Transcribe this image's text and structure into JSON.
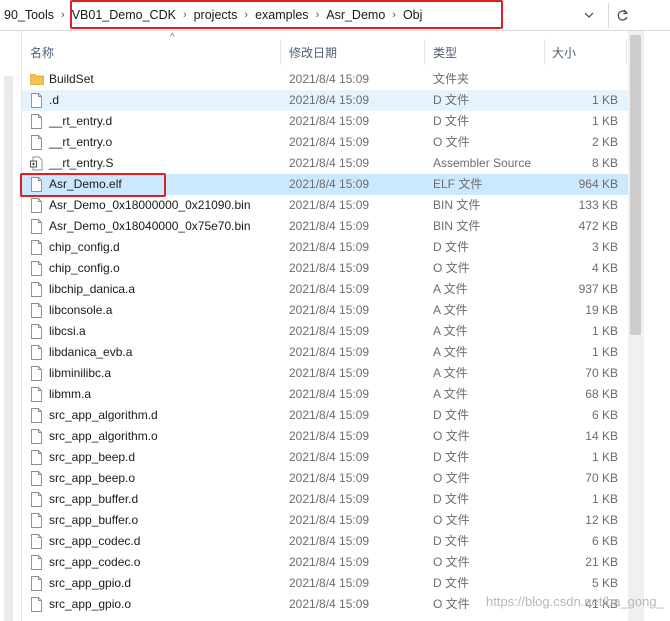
{
  "breadcrumb": {
    "items": [
      "90_Tools",
      "VB01_Demo_CDK",
      "projects",
      "examples",
      "Asr_Demo",
      "Obj"
    ],
    "separator": "›"
  },
  "address_bar": {
    "dropdown_icon": "chevron-down-icon",
    "refresh_icon": "refresh-icon"
  },
  "columns": {
    "name": "名称",
    "date": "修改日期",
    "type": "类型",
    "size": "大小",
    "sort_indicator": "^"
  },
  "files": [
    {
      "name": "BuildSet",
      "date": "2021/8/4 15:09",
      "type": "文件夹",
      "size": "",
      "icon": "folder-icon"
    },
    {
      "name": ".d",
      "date": "2021/8/4 15:09",
      "type": "D 文件",
      "size": "1 KB",
      "icon": "file-icon"
    },
    {
      "name": "__rt_entry.d",
      "date": "2021/8/4 15:09",
      "type": "D 文件",
      "size": "1 KB",
      "icon": "file-icon"
    },
    {
      "name": "__rt_entry.o",
      "date": "2021/8/4 15:09",
      "type": "O 文件",
      "size": "2 KB",
      "icon": "file-icon"
    },
    {
      "name": "__rt_entry.S",
      "date": "2021/8/4 15:09",
      "type": "Assembler Source",
      "size": "8 KB",
      "icon": "assembler-source-icon"
    },
    {
      "name": "Asr_Demo.elf",
      "date": "2021/8/4 15:09",
      "type": "ELF 文件",
      "size": "964 KB",
      "icon": "file-icon"
    },
    {
      "name": "Asr_Demo_0x18000000_0x21090.bin",
      "date": "2021/8/4 15:09",
      "type": "BIN 文件",
      "size": "133 KB",
      "icon": "file-icon"
    },
    {
      "name": "Asr_Demo_0x18040000_0x75e70.bin",
      "date": "2021/8/4 15:09",
      "type": "BIN 文件",
      "size": "472 KB",
      "icon": "file-icon"
    },
    {
      "name": "chip_config.d",
      "date": "2021/8/4 15:09",
      "type": "D 文件",
      "size": "3 KB",
      "icon": "file-icon"
    },
    {
      "name": "chip_config.o",
      "date": "2021/8/4 15:09",
      "type": "O 文件",
      "size": "4 KB",
      "icon": "file-icon"
    },
    {
      "name": "libchip_danica.a",
      "date": "2021/8/4 15:09",
      "type": "A 文件",
      "size": "937 KB",
      "icon": "file-icon"
    },
    {
      "name": "libconsole.a",
      "date": "2021/8/4 15:09",
      "type": "A 文件",
      "size": "19 KB",
      "icon": "file-icon"
    },
    {
      "name": "libcsi.a",
      "date": "2021/8/4 15:09",
      "type": "A 文件",
      "size": "1 KB",
      "icon": "file-icon"
    },
    {
      "name": "libdanica_evb.a",
      "date": "2021/8/4 15:09",
      "type": "A 文件",
      "size": "1 KB",
      "icon": "file-icon"
    },
    {
      "name": "libminilibc.a",
      "date": "2021/8/4 15:09",
      "type": "A 文件",
      "size": "70 KB",
      "icon": "file-icon"
    },
    {
      "name": "libmm.a",
      "date": "2021/8/4 15:09",
      "type": "A 文件",
      "size": "68 KB",
      "icon": "file-icon"
    },
    {
      "name": "src_app_algorithm.d",
      "date": "2021/8/4 15:09",
      "type": "D 文件",
      "size": "6 KB",
      "icon": "file-icon"
    },
    {
      "name": "src_app_algorithm.o",
      "date": "2021/8/4 15:09",
      "type": "O 文件",
      "size": "14 KB",
      "icon": "file-icon"
    },
    {
      "name": "src_app_beep.d",
      "date": "2021/8/4 15:09",
      "type": "D 文件",
      "size": "1 KB",
      "icon": "file-icon"
    },
    {
      "name": "src_app_beep.o",
      "date": "2021/8/4 15:09",
      "type": "O 文件",
      "size": "70 KB",
      "icon": "file-icon"
    },
    {
      "name": "src_app_buffer.d",
      "date": "2021/8/4 15:09",
      "type": "D 文件",
      "size": "1 KB",
      "icon": "file-icon"
    },
    {
      "name": "src_app_buffer.o",
      "date": "2021/8/4 15:09",
      "type": "O 文件",
      "size": "12 KB",
      "icon": "file-icon"
    },
    {
      "name": "src_app_codec.d",
      "date": "2021/8/4 15:09",
      "type": "D 文件",
      "size": "6 KB",
      "icon": "file-icon"
    },
    {
      "name": "src_app_codec.o",
      "date": "2021/8/4 15:09",
      "type": "O 文件",
      "size": "21 KB",
      "icon": "file-icon"
    },
    {
      "name": "src_app_gpio.d",
      "date": "2021/8/4 15:09",
      "type": "D 文件",
      "size": "5 KB",
      "icon": "file-icon"
    },
    {
      "name": "src_app_gpio.o",
      "date": "2021/8/4 15:09",
      "type": "O 文件",
      "size": "41 KB",
      "icon": "file-icon"
    }
  ],
  "hover_row": ".d",
  "selected_row": "Asr_Demo.elf",
  "watermark": "https://blog.csdn.net/ba_gong_",
  "colors": {
    "highlight_box": "#e02020",
    "selection": "#cce8ff",
    "hover": "#e5f3ff",
    "folder": "#f3c54d"
  }
}
